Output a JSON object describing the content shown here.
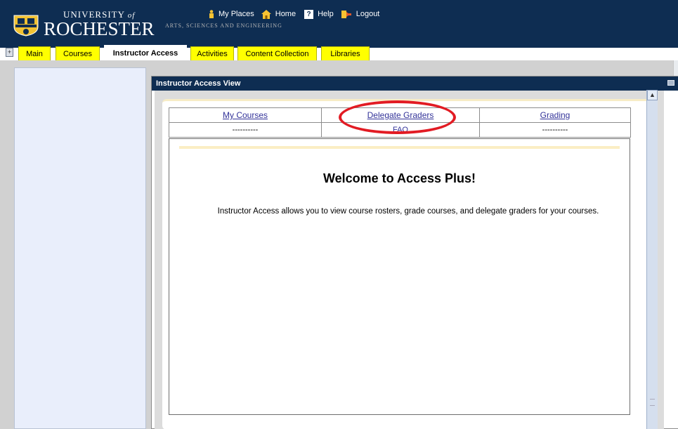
{
  "header": {
    "logo_university": "UNIVERSITY",
    "logo_of": "of",
    "logo_rochester": "ROCHESTER",
    "logo_subtitle": "ARTS, SCIENCES AND ENGINEERING",
    "brand_color": "#0e2d52"
  },
  "top_links": [
    {
      "label": "My Places",
      "icon": "person-icon"
    },
    {
      "label": "Home",
      "icon": "home-icon"
    },
    {
      "label": "Help",
      "icon": "help-icon"
    },
    {
      "label": "Logout",
      "icon": "logout-icon"
    }
  ],
  "tabs": [
    {
      "label": "Main",
      "active": false
    },
    {
      "label": "Courses",
      "active": false
    },
    {
      "label": "Instructor Access",
      "active": true
    },
    {
      "label": "Activities",
      "active": false
    },
    {
      "label": "Content Collection",
      "active": false
    },
    {
      "label": "Libraries",
      "active": false
    }
  ],
  "tab_color": "#ffff00",
  "portlet": {
    "title": "Instructor Access View"
  },
  "menu": {
    "row1": [
      "My Courses",
      "Delegate Graders",
      "Grading"
    ],
    "row2": [
      "----------",
      "FAQ",
      "----------"
    ]
  },
  "main": {
    "welcome": "Welcome to Access Plus!",
    "intro": "Instructor Access allows you to view course rosters, grade courses, and delegate graders for your courses."
  },
  "highlight_color": "#e21b23"
}
